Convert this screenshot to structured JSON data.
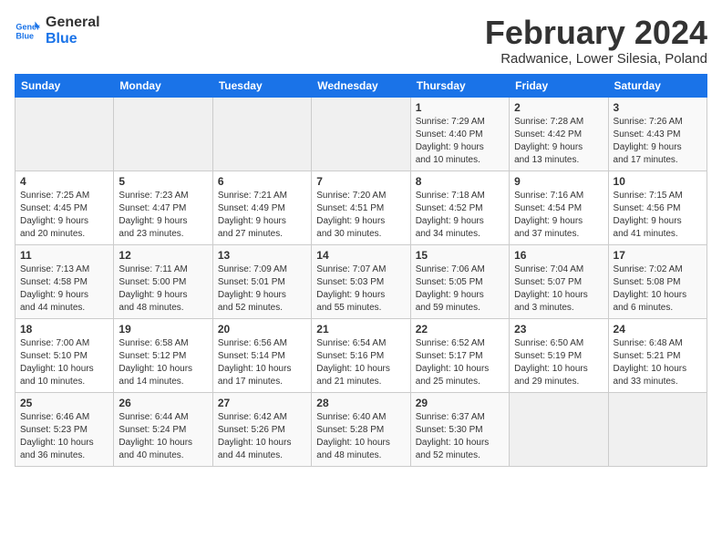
{
  "header": {
    "logo_line1": "General",
    "logo_line2": "Blue",
    "title": "February 2024",
    "subtitle": "Radwanice, Lower Silesia, Poland"
  },
  "weekdays": [
    "Sunday",
    "Monday",
    "Tuesday",
    "Wednesday",
    "Thursday",
    "Friday",
    "Saturday"
  ],
  "weeks": [
    [
      {
        "day": "",
        "info": ""
      },
      {
        "day": "",
        "info": ""
      },
      {
        "day": "",
        "info": ""
      },
      {
        "day": "",
        "info": ""
      },
      {
        "day": "1",
        "info": "Sunrise: 7:29 AM\nSunset: 4:40 PM\nDaylight: 9 hours\nand 10 minutes."
      },
      {
        "day": "2",
        "info": "Sunrise: 7:28 AM\nSunset: 4:42 PM\nDaylight: 9 hours\nand 13 minutes."
      },
      {
        "day": "3",
        "info": "Sunrise: 7:26 AM\nSunset: 4:43 PM\nDaylight: 9 hours\nand 17 minutes."
      }
    ],
    [
      {
        "day": "4",
        "info": "Sunrise: 7:25 AM\nSunset: 4:45 PM\nDaylight: 9 hours\nand 20 minutes."
      },
      {
        "day": "5",
        "info": "Sunrise: 7:23 AM\nSunset: 4:47 PM\nDaylight: 9 hours\nand 23 minutes."
      },
      {
        "day": "6",
        "info": "Sunrise: 7:21 AM\nSunset: 4:49 PM\nDaylight: 9 hours\nand 27 minutes."
      },
      {
        "day": "7",
        "info": "Sunrise: 7:20 AM\nSunset: 4:51 PM\nDaylight: 9 hours\nand 30 minutes."
      },
      {
        "day": "8",
        "info": "Sunrise: 7:18 AM\nSunset: 4:52 PM\nDaylight: 9 hours\nand 34 minutes."
      },
      {
        "day": "9",
        "info": "Sunrise: 7:16 AM\nSunset: 4:54 PM\nDaylight: 9 hours\nand 37 minutes."
      },
      {
        "day": "10",
        "info": "Sunrise: 7:15 AM\nSunset: 4:56 PM\nDaylight: 9 hours\nand 41 minutes."
      }
    ],
    [
      {
        "day": "11",
        "info": "Sunrise: 7:13 AM\nSunset: 4:58 PM\nDaylight: 9 hours\nand 44 minutes."
      },
      {
        "day": "12",
        "info": "Sunrise: 7:11 AM\nSunset: 5:00 PM\nDaylight: 9 hours\nand 48 minutes."
      },
      {
        "day": "13",
        "info": "Sunrise: 7:09 AM\nSunset: 5:01 PM\nDaylight: 9 hours\nand 52 minutes."
      },
      {
        "day": "14",
        "info": "Sunrise: 7:07 AM\nSunset: 5:03 PM\nDaylight: 9 hours\nand 55 minutes."
      },
      {
        "day": "15",
        "info": "Sunrise: 7:06 AM\nSunset: 5:05 PM\nDaylight: 9 hours\nand 59 minutes."
      },
      {
        "day": "16",
        "info": "Sunrise: 7:04 AM\nSunset: 5:07 PM\nDaylight: 10 hours\nand 3 minutes."
      },
      {
        "day": "17",
        "info": "Sunrise: 7:02 AM\nSunset: 5:08 PM\nDaylight: 10 hours\nand 6 minutes."
      }
    ],
    [
      {
        "day": "18",
        "info": "Sunrise: 7:00 AM\nSunset: 5:10 PM\nDaylight: 10 hours\nand 10 minutes."
      },
      {
        "day": "19",
        "info": "Sunrise: 6:58 AM\nSunset: 5:12 PM\nDaylight: 10 hours\nand 14 minutes."
      },
      {
        "day": "20",
        "info": "Sunrise: 6:56 AM\nSunset: 5:14 PM\nDaylight: 10 hours\nand 17 minutes."
      },
      {
        "day": "21",
        "info": "Sunrise: 6:54 AM\nSunset: 5:16 PM\nDaylight: 10 hours\nand 21 minutes."
      },
      {
        "day": "22",
        "info": "Sunrise: 6:52 AM\nSunset: 5:17 PM\nDaylight: 10 hours\nand 25 minutes."
      },
      {
        "day": "23",
        "info": "Sunrise: 6:50 AM\nSunset: 5:19 PM\nDaylight: 10 hours\nand 29 minutes."
      },
      {
        "day": "24",
        "info": "Sunrise: 6:48 AM\nSunset: 5:21 PM\nDaylight: 10 hours\nand 33 minutes."
      }
    ],
    [
      {
        "day": "25",
        "info": "Sunrise: 6:46 AM\nSunset: 5:23 PM\nDaylight: 10 hours\nand 36 minutes."
      },
      {
        "day": "26",
        "info": "Sunrise: 6:44 AM\nSunset: 5:24 PM\nDaylight: 10 hours\nand 40 minutes."
      },
      {
        "day": "27",
        "info": "Sunrise: 6:42 AM\nSunset: 5:26 PM\nDaylight: 10 hours\nand 44 minutes."
      },
      {
        "day": "28",
        "info": "Sunrise: 6:40 AM\nSunset: 5:28 PM\nDaylight: 10 hours\nand 48 minutes."
      },
      {
        "day": "29",
        "info": "Sunrise: 6:37 AM\nSunset: 5:30 PM\nDaylight: 10 hours\nand 52 minutes."
      },
      {
        "day": "",
        "info": ""
      },
      {
        "day": "",
        "info": ""
      }
    ]
  ]
}
